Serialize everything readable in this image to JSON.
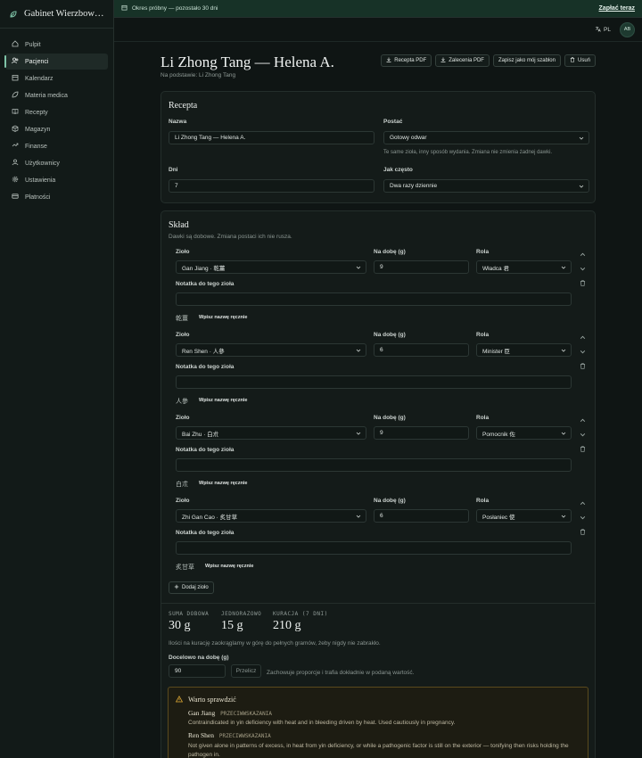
{
  "app": {
    "name": "Gabinet Wierzbow…"
  },
  "sidebar": {
    "items": [
      {
        "label": "Pulpit",
        "icon": "home-icon"
      },
      {
        "label": "Pacjenci",
        "icon": "users-icon",
        "active": true
      },
      {
        "label": "Kalendarz",
        "icon": "calendar-icon"
      },
      {
        "label": "Materia medica",
        "icon": "leaf-icon"
      },
      {
        "label": "Recepty",
        "icon": "book-icon"
      },
      {
        "label": "Magazyn",
        "icon": "box-icon"
      },
      {
        "label": "Finanse",
        "icon": "finance-icon"
      },
      {
        "label": "Użytkownicy",
        "icon": "user-group-icon"
      },
      {
        "label": "Ustawienia",
        "icon": "gear-icon"
      },
      {
        "label": "Płatności",
        "icon": "card-icon"
      }
    ]
  },
  "trial": {
    "text": "Okres próbny — pozostało 30 dni",
    "pay_label": "Zapłać teraz"
  },
  "topbar": {
    "lang": "PL",
    "avatar": "AB"
  },
  "page": {
    "title": "Li Zhong Tang — Helena A.",
    "subtitle": "Na podstawie: Li Zhong Tang",
    "actions": [
      "Recepta PDF",
      "Zalecenia PDF",
      "Zapisz jako mój szablon",
      "Usuń"
    ]
  },
  "recipe": {
    "title": "Recepta",
    "name_label": "Nazwa",
    "name_value": "Li Zhong Tang — Helena A.",
    "form_label": "Postać",
    "form_value": "Gotowy odwar",
    "form_hint": "Te same zioła, inny sposób wydania. Zmiana nie zmienia żadnej dawki.",
    "days_label": "Dni",
    "days_value": "7",
    "freq_label": "Jak często",
    "freq_value": "Dwa razy dziennie"
  },
  "composition": {
    "title": "Skład",
    "subtitle": "Dawki są dobowe. Zmiana postaci ich nie rusza.",
    "col_herb": "Zioło",
    "col_dose": "Na dobę (g)",
    "col_role": "Rola",
    "note_label": "Notatka do tego zioła",
    "manual_label": "Wpisz nazwę ręcznie",
    "herbs": [
      {
        "herb": "Gan Jiang · 乾薑",
        "dose": "9",
        "role": "Władca 君",
        "cjk": "乾薑"
      },
      {
        "herb": "Ren Shen · 人參",
        "dose": "6",
        "role": "Minister 臣",
        "cjk": "人參"
      },
      {
        "herb": "Bai Zhu · 白朮",
        "dose": "9",
        "role": "Pomocnik 佐",
        "cjk": "白朮"
      },
      {
        "herb": "Zhi Gan Cao · 炙甘草",
        "dose": "6",
        "role": "Posłaniec 使",
        "cjk": "炙甘草"
      }
    ],
    "add_label": "Dodaj zioło",
    "stats": [
      {
        "label": "SUMA DOBOWA",
        "value": "30 g"
      },
      {
        "label": "JEDNORAZOWO",
        "value": "15 g"
      },
      {
        "label": "KURACJA (7 DNI)",
        "value": "210 g"
      }
    ],
    "round_note": "Ilości na kurację zaokrąglamy w górę do pełnych gramów, żeby nigdy nie zabrakło.",
    "target_label": "Docelowo na dobę (g)",
    "target_value": "90",
    "recalc_label": "Przelicz",
    "target_hint": "Zachowuje proporcje i trafia dokładnie w podaną wartość."
  },
  "warning": {
    "title": "Warto sprawdzić",
    "items": [
      {
        "herb": "Gan Jiang",
        "tag": "PRZECIWWSKAZANIA",
        "text": "Contraindicated in yin deficiency with heat and in bleeding driven by heat. Used cautiously in pregnancy."
      },
      {
        "herb": "Ren Shen",
        "tag": "PRZECIWWSKAZANIA",
        "text": "Not given alone in patterns of excess, in heat from yin deficiency, or while a pathogenic factor is still on the exterior — tonifying then risks holding the pathogen in."
      }
    ]
  },
  "colors": {
    "accent": "#7fc4a8",
    "bg": "#0f1514",
    "card": "#141b19",
    "warning": "#d9a534"
  }
}
